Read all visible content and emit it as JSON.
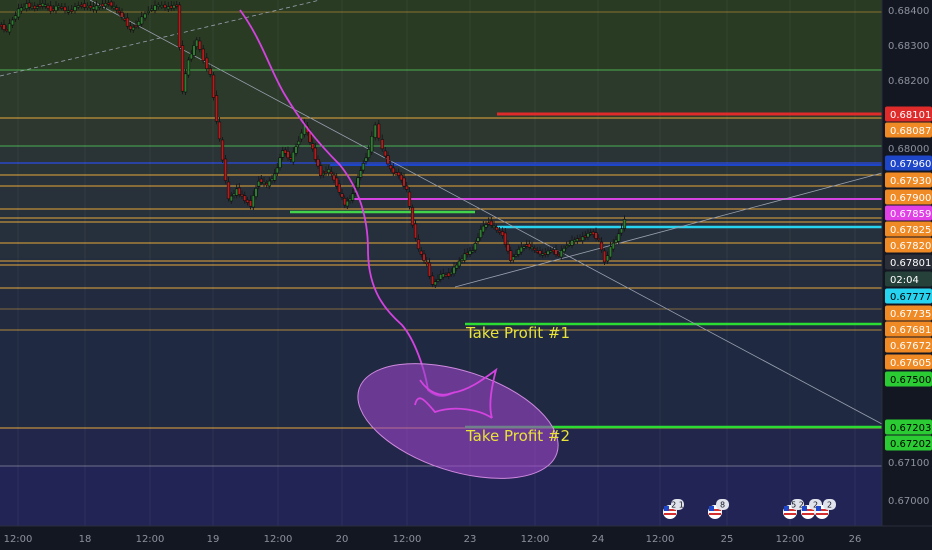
{
  "chart_data": {
    "type": "candlestick",
    "title": "",
    "y_axis": {
      "range": [
        0.6695,
        0.6845
      ],
      "ticks": [
        "0.68400",
        "0.68300",
        "0.68200",
        "0.68000",
        "0.67300",
        "0.67100",
        "0.67000"
      ]
    },
    "x_axis": {
      "tick_labels": [
        "12:00",
        "18",
        "12:00",
        "19",
        "12:00",
        "20",
        "12:00",
        "23",
        "12:00",
        "24",
        "12:00",
        "25",
        "12:00",
        "26"
      ]
    },
    "price_badges": [
      {
        "label": "0.68101",
        "bg": "#e02b2b",
        "fg": "#ffffff"
      },
      {
        "label": "0.68087",
        "bg": "#f08a24",
        "fg": "#ffffff"
      },
      {
        "label": "0.67960",
        "bg": "#1d46c8",
        "fg": "#ffffff"
      },
      {
        "label": "0.67930",
        "bg": "#f08a24",
        "fg": "#ffffff"
      },
      {
        "label": "0.67900",
        "bg": "#f08a24",
        "fg": "#ffffff"
      },
      {
        "label": "0.67859",
        "bg": "#e040e6",
        "fg": "#ffffff"
      },
      {
        "label": "0.67825",
        "bg": "#f08a24",
        "fg": "#ffffff"
      },
      {
        "label": "0.67820",
        "bg": "#f08a24",
        "fg": "#ffffff"
      },
      {
        "label": "0.67801",
        "bg": "#2a2e39",
        "fg": "#ffffff"
      },
      {
        "label": "02:04",
        "bg": "#26413a",
        "fg": "#ffffff"
      },
      {
        "label": "0.67777",
        "bg": "#27d4f0",
        "fg": "#000000"
      },
      {
        "label": "0.67735",
        "bg": "#f08a24",
        "fg": "#ffffff"
      },
      {
        "label": "0.67681",
        "bg": "#f08a24",
        "fg": "#ffffff"
      },
      {
        "label": "0.67672",
        "bg": "#f08a24",
        "fg": "#ffffff"
      },
      {
        "label": "0.67605",
        "bg": "#f08a24",
        "fg": "#ffffff"
      },
      {
        "label": "0.67500",
        "bg": "#2bcc33",
        "fg": "#000000"
      },
      {
        "label": "0.67203",
        "bg": "#2bcc33",
        "fg": "#000000"
      },
      {
        "label": "0.67202",
        "bg": "#2bcc33",
        "fg": "#000000"
      }
    ],
    "annotations": [
      {
        "text": "Take Profit #1",
        "color": "#e8e23a"
      },
      {
        "text": "Take Profit #2",
        "color": "#e8e23a"
      }
    ],
    "event_markers": [
      {
        "flag": "us-flag-icon",
        "count": "2 1"
      },
      {
        "flag": "us-flag-icon",
        "count": "8"
      },
      {
        "flag": "us-flag-icon",
        "count": "5 2"
      },
      {
        "flag": "us-flag-icon",
        "count": "2"
      },
      {
        "flag": "us-flag-icon",
        "count": "2"
      }
    ],
    "colors": {
      "background": "#131722",
      "up_candle": "#2e7d32",
      "down_candle": "#b71c1c",
      "level_orange": "#f0a030",
      "take_profit_line": "#2bdc33",
      "drawing_magenta": "#d443e0",
      "target_ellipse": "#9c46c8"
    }
  }
}
